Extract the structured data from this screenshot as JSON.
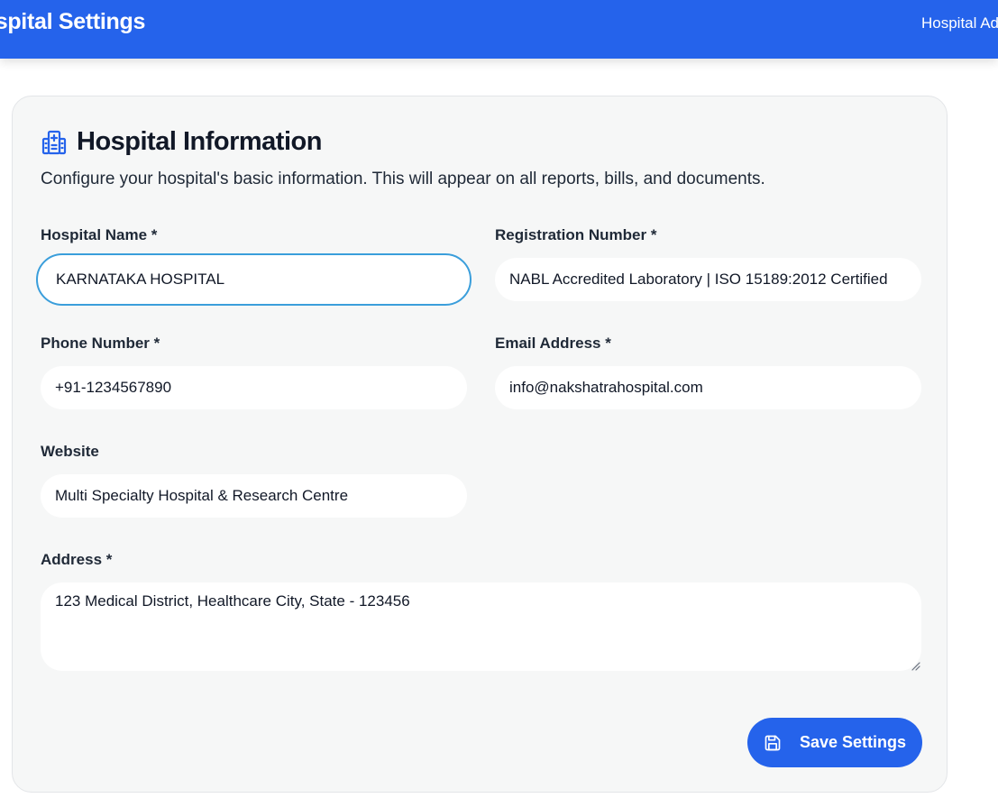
{
  "header": {
    "title": "Hospital Settings",
    "user_label": "Hospital Admin"
  },
  "card": {
    "title": "Hospital Information",
    "subtitle": "Configure your hospital's basic information. This will appear on all reports, bills, and documents.",
    "icon": "hospital-icon"
  },
  "form": {
    "hospital_name": {
      "label": "Hospital Name *",
      "value": "KARNATAKA HOSPITAL"
    },
    "registration_number": {
      "label": "Registration Number *",
      "value": "NABL Accredited Laboratory | ISO 15189:2012 Certified"
    },
    "phone_number": {
      "label": "Phone Number *",
      "value": "+91-1234567890"
    },
    "email_address": {
      "label": "Email Address *",
      "value": "info@nakshatrahospital.com"
    },
    "website": {
      "label": "Website",
      "value": "Multi Specialty Hospital & Research Centre"
    },
    "address": {
      "label": "Address *",
      "value": "123 Medical District, Healthcare City, State - 123456"
    }
  },
  "actions": {
    "save_label": "Save Settings",
    "save_icon": "save-icon"
  },
  "colors": {
    "primary": "#2563eb",
    "focus_ring": "#3a9edb",
    "card_background": "#f6f7f7"
  }
}
